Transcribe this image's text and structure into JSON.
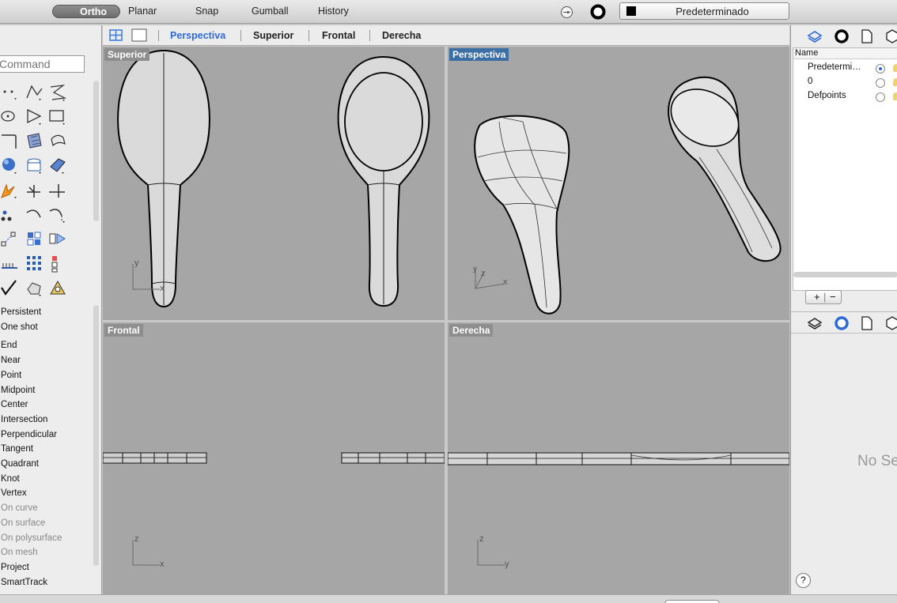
{
  "toolbar": {
    "ortho": "Ortho",
    "planar": "Planar",
    "snap": "Snap",
    "gumball": "Gumball",
    "history": "History",
    "current_layer": "Predeterminado",
    "layer_color": "#000000"
  },
  "viewport_tabs": [
    "Perspectiva",
    "Superior",
    "Frontal",
    "Derecha"
  ],
  "active_viewport": "Perspectiva",
  "command": {
    "placeholder": "Command"
  },
  "osnaps": {
    "modes": [
      "Persistent",
      "One shot"
    ],
    "items": [
      {
        "label": "End",
        "enabled": true
      },
      {
        "label": "Near",
        "enabled": true
      },
      {
        "label": "Point",
        "enabled": true
      },
      {
        "label": "Midpoint",
        "enabled": true
      },
      {
        "label": "Center",
        "enabled": true
      },
      {
        "label": "Intersection",
        "enabled": true
      },
      {
        "label": "Perpendicular",
        "enabled": true
      },
      {
        "label": "Tangent",
        "enabled": true
      },
      {
        "label": "Quadrant",
        "enabled": true
      },
      {
        "label": "Knot",
        "enabled": true
      },
      {
        "label": "Vertex",
        "enabled": true
      },
      {
        "label": "On curve",
        "enabled": false
      },
      {
        "label": "On surface",
        "enabled": false
      },
      {
        "label": "On polysurface",
        "enabled": false
      },
      {
        "label": "On mesh",
        "enabled": false
      },
      {
        "label": "Project",
        "enabled": true
      },
      {
        "label": "SmartTrack",
        "enabled": true
      }
    ]
  },
  "viewports": {
    "top": {
      "label": "Superior",
      "axes": [
        "x",
        "y"
      ]
    },
    "perspective": {
      "label": "Perspectiva",
      "axes": [
        "x",
        "y",
        "z"
      ]
    },
    "front": {
      "label": "Frontal",
      "axes": [
        "x",
        "z"
      ]
    },
    "right": {
      "label": "Derecha",
      "axes": [
        "y",
        "z"
      ]
    }
  },
  "layers_panel": {
    "header": "Name",
    "layers": [
      {
        "name": "Predetermi…",
        "current": true
      },
      {
        "name": "0",
        "current": false
      },
      {
        "name": "Defpoints",
        "current": false
      }
    ],
    "add": "+",
    "remove": "−"
  },
  "properties_panel": {
    "empty_text": "No Se",
    "help": "?"
  },
  "colors": {
    "accent": "#2d6ad8",
    "viewport_bg": "#a6a6a6",
    "active_label": "#3a6ea5"
  }
}
